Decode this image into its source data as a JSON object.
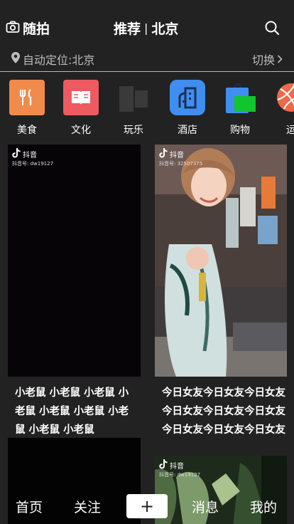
{
  "header": {
    "camera_label": "随拍",
    "title_main": "推荐",
    "title_sep": "|",
    "title_city": "北京"
  },
  "location": {
    "current": "自动定位:北京",
    "switch_label": "切换"
  },
  "categories": [
    {
      "label": "美食",
      "icon": "food-icon",
      "color": "#F18B4B"
    },
    {
      "label": "文化",
      "icon": "book-icon",
      "color": "#EE5A5F"
    },
    {
      "label": "玩乐",
      "icon": "flag-icon",
      "color": "#3A3A3A"
    },
    {
      "label": "酒店",
      "icon": "hotel-icon",
      "color": "#3F8EF0"
    },
    {
      "label": "购物",
      "icon": "shopping-bag-icon",
      "color": "#21C645"
    },
    {
      "label": "运",
      "icon": "ball-icon",
      "color": "#F06848"
    }
  ],
  "feed": [
    {
      "watermark": "抖音",
      "account": "抖音号: dw19127",
      "caption": "小老鼠 小老鼠 小老鼠 小老鼠 小老鼠 小老鼠 小老鼠 小老鼠 小老鼠"
    },
    {
      "watermark": "抖音",
      "account": "抖音号: 32507375",
      "caption": "今日女友今日女友今日女友 今日女友今日女友今日女友 今日女友今日女友今日女友"
    },
    {
      "watermark": "抖音",
      "account": "抖音号: dw19127",
      "caption": ""
    }
  ],
  "tabbar": {
    "home": "首页",
    "follow": "关注",
    "add": "+",
    "messages": "消息",
    "me": "我的"
  },
  "colors": {
    "background": "#222222",
    "divider": "#b8b8b8",
    "muted_text": "#bcbcbc"
  }
}
